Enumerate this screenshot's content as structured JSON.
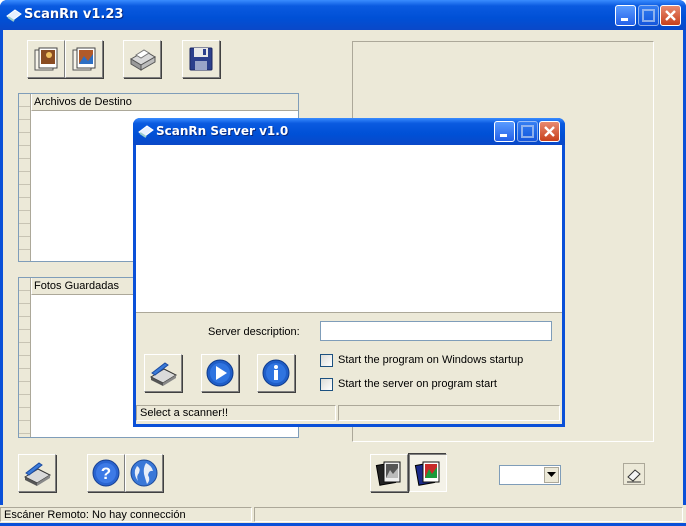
{
  "main_window": {
    "title": "ScanRn v1.23",
    "panels": {
      "destination_header": "Archivos de Destino",
      "saved_header": "Fotos Guardadas"
    },
    "combo_value": "",
    "status_text": "Escáner Remoto: No hay connección",
    "icons": {
      "scan_a": "photo-stack-icon",
      "scan_b": "photo-color-icon",
      "print": "printer-icon",
      "save": "floppy-disk-icon",
      "scanner": "scanner-icon",
      "help": "help-icon",
      "web": "globe-icon",
      "bw": "bw-photos-icon",
      "color": "color-photos-icon",
      "erase": "eraser-icon"
    }
  },
  "server_window": {
    "title": "ScanRn Server v1.0",
    "description_label": "Server description:",
    "description_value": "",
    "startup_label": "Start the program on Windows startup",
    "autostart_label": "Start the server on program start",
    "startup_checked": false,
    "autostart_checked": false,
    "status_text": "Select a scanner!!",
    "status_right": ""
  },
  "colors": {
    "titlebar": "#0a50d8",
    "face": "#ece9d8",
    "border": "#7f9db9"
  }
}
